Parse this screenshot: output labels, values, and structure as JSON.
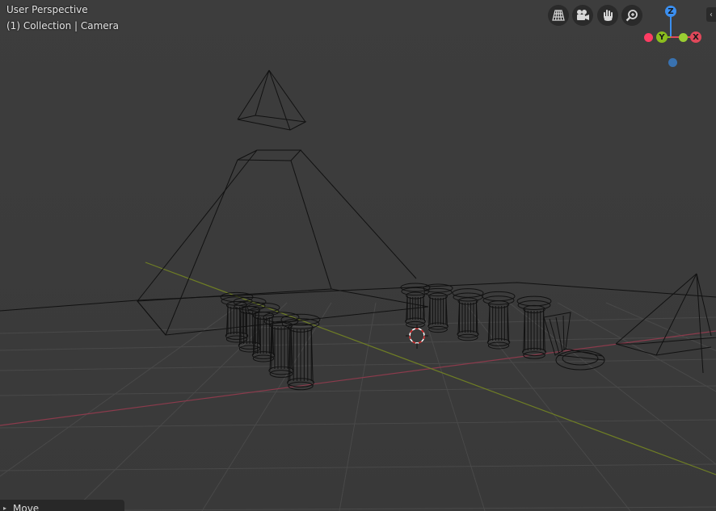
{
  "viewport": {
    "view_name": "User Perspective",
    "context_label": "(1) Collection | Camera"
  },
  "navigation": {
    "buttons": [
      {
        "name": "toggle-camera-view-button",
        "icon": "perspective-grid-icon"
      },
      {
        "name": "camera-view-button",
        "icon": "video-camera-icon"
      },
      {
        "name": "pan-view-button",
        "icon": "hand-icon"
      },
      {
        "name": "zoom-view-button",
        "icon": "zoom-icon"
      }
    ]
  },
  "gizmo": {
    "z_label": "Z",
    "y_label": "Y",
    "x_label": "X",
    "colors": {
      "x": "#e0485a",
      "y": "#8bbd1e",
      "z": "#3b8ff0",
      "neg_x": "#ff3c63",
      "neg_y": "#9acd32",
      "neg_z": "#3972b0"
    }
  },
  "sidebar_toggle": {
    "glyph": "‹"
  },
  "operator_panel": {
    "label": "Move",
    "expand_glyph": "▸"
  }
}
